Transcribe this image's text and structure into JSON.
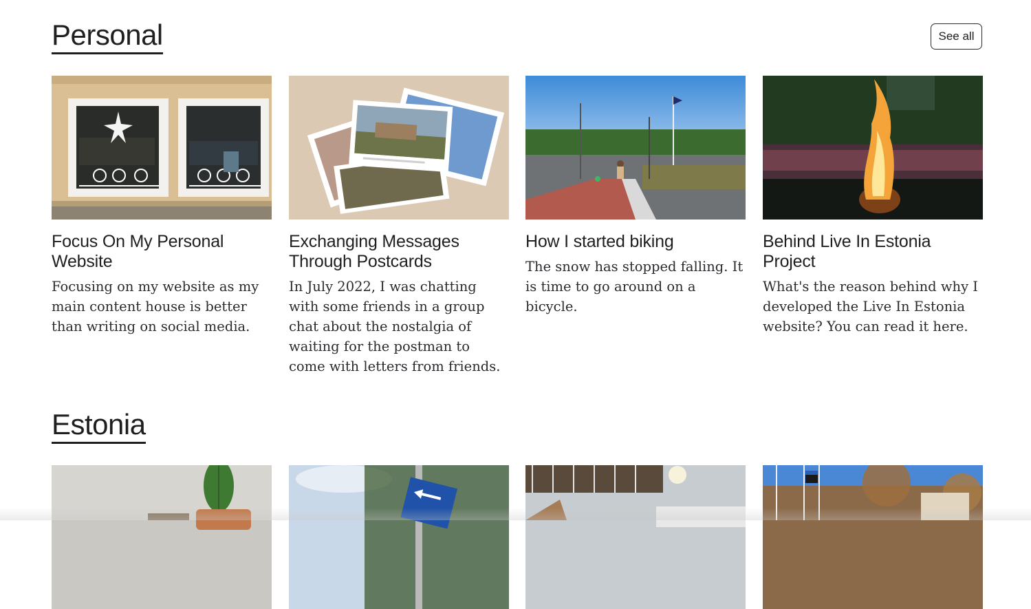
{
  "sections": [
    {
      "title": "Personal",
      "see_all_label": "See all",
      "cards": [
        {
          "title": "Focus On My Personal Website",
          "description": "Focusing on my website as my main content house is better than writing on social media.",
          "image": "cafe-window-photo"
        },
        {
          "title": "Exchanging Messages Through Postcards",
          "description": "In July 2022, I was chatting with some friends in a group chat about the nostalgia of waiting for the postman to come with letters from friends.",
          "image": "postcards-photo"
        },
        {
          "title": "How I started biking",
          "description": "The snow has stopped falling. It is time to go around on a bicycle.",
          "image": "bike-road-photo"
        },
        {
          "title": "Behind Live In Estonia Project",
          "description": "What's the reason behind why I developed the Live In Estonia website? You can read it here.",
          "image": "bonfire-photo"
        }
      ]
    },
    {
      "title": "Estonia",
      "cards": [
        {
          "image": "cactus-photo"
        },
        {
          "image": "bike-sign-photo"
        },
        {
          "image": "interior-photo"
        },
        {
          "image": "flags-square-photo"
        }
      ]
    }
  ],
  "colors": {
    "text": "#1f1f22",
    "background": "#ffffff",
    "border": "#2a2a2e"
  }
}
